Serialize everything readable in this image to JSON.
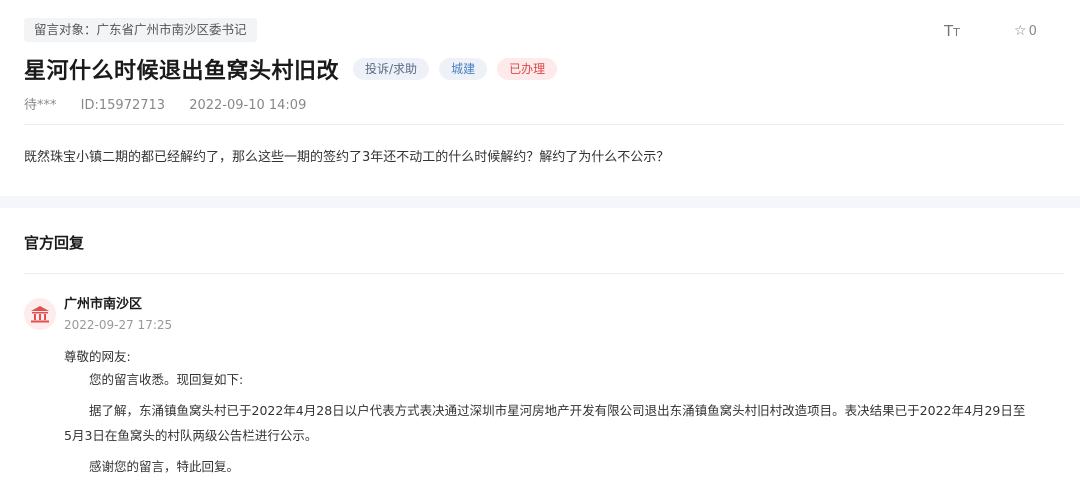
{
  "header": {
    "target_label": "留言对象：广东省广州市南沙区委书记",
    "font_toggle": "TT",
    "favorite_count": "0"
  },
  "post": {
    "title": "星河什么时候退出鱼窝头村旧改",
    "tags": {
      "type": "投诉/求助",
      "field": "城建",
      "status": "已办理"
    },
    "author": "待***",
    "id": "ID:15972713",
    "time": "2022-09-10 14:09",
    "content": "既然珠宝小镇二期的都已经解约了，那么这些一期的签约了3年还不动工的什么时候解约？解约了为什么不公示？"
  },
  "reply": {
    "heading": "官方回复",
    "org_name": "广州市南沙区",
    "time": "2022-09-27 17:25",
    "greeting": "尊敬的网友:",
    "line1": "您的留言收悉。现回复如下:",
    "line2a": "据了解，东涌镇鱼窝头村已于2022年4月28日以户代表方式表决通过深圳市星河房地产开发有限公司退出东涌镇鱼窝头村旧村改造项目。表决结果已于2022年4月29日至",
    "line2b": "5月3日在鱼窝头的村队两级公告栏进行公示。",
    "closing": "感谢您的留言，特此回复。"
  },
  "colors": {
    "status_red": "#e04848",
    "field_blue": "#4a7fc1",
    "gov_icon_red": "#e05050"
  },
  "icons": [
    "star-icon",
    "font-size-icon",
    "government-building-icon"
  ]
}
